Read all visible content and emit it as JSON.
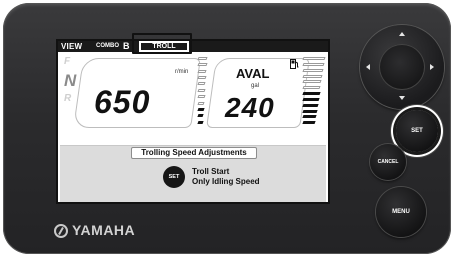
{
  "screen": {
    "view_label": "VIEW",
    "combo_label": "COMBO",
    "combo_letter": "B",
    "mode_tab": "TROLL",
    "gear": {
      "forward": "F",
      "neutral": "N",
      "reverse": "R",
      "active": "N"
    },
    "rpm": {
      "unit": "r/min",
      "value": "650",
      "bar_level": 3,
      "bar_count": 11
    },
    "fuel": {
      "title": "AVAL",
      "unit": "gal",
      "value": "240",
      "bar_level": 6,
      "bar_count": 12,
      "icon": "fuel-pump-icon"
    }
  },
  "message": {
    "title": "Trolling Speed Adjustments",
    "set_badge": "SET",
    "line1": "Troll Start",
    "line2": "Only Idling Speed"
  },
  "brand": {
    "name": "YAMAHA",
    "icon": "tuning-fork-emblem-icon"
  },
  "controls": {
    "set_label": "SET",
    "cancel_label": "CANCEL",
    "menu_label": "MENU",
    "dpad_icons": [
      "arrow-up-icon",
      "arrow-down-icon",
      "arrow-left-icon",
      "arrow-right-icon"
    ]
  },
  "colors": {
    "bezel": "#2b2b2d",
    "screen_bg": "#ffffff",
    "message_bg": "#dcdcdc",
    "brand_text": "#d2d2d2"
  }
}
